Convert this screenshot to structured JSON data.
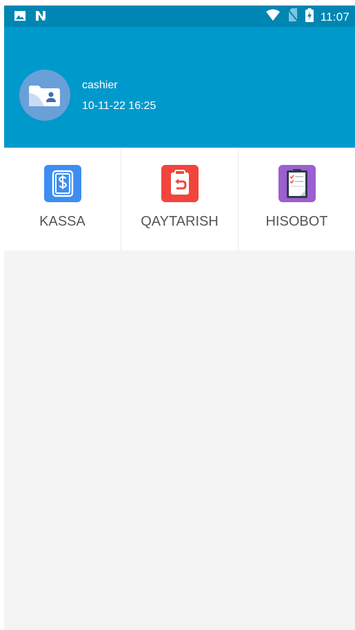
{
  "status_bar": {
    "left_icons": [
      "image-icon",
      "n-notification-icon"
    ],
    "right_icons": [
      "wifi-icon",
      "no-sim-icon",
      "battery-charging-icon"
    ],
    "time": "11:07"
  },
  "header": {
    "avatar_icon": "user-folder-icon",
    "username": "cashier",
    "datetime": "10-11-22 16:25"
  },
  "menu": {
    "items": [
      {
        "label": "KASSA",
        "icon": "cash-register-icon",
        "color": "#3d8ef0"
      },
      {
        "label": "QAYTARISH",
        "icon": "return-clipboard-icon",
        "color": "#f1453d"
      },
      {
        "label": "HISOBOT",
        "icon": "report-checklist-icon",
        "color": "#9b5fd0"
      }
    ]
  },
  "colors": {
    "status_bar": "#0086b3",
    "header": "#0099cc",
    "background": "#f4f4f4"
  }
}
